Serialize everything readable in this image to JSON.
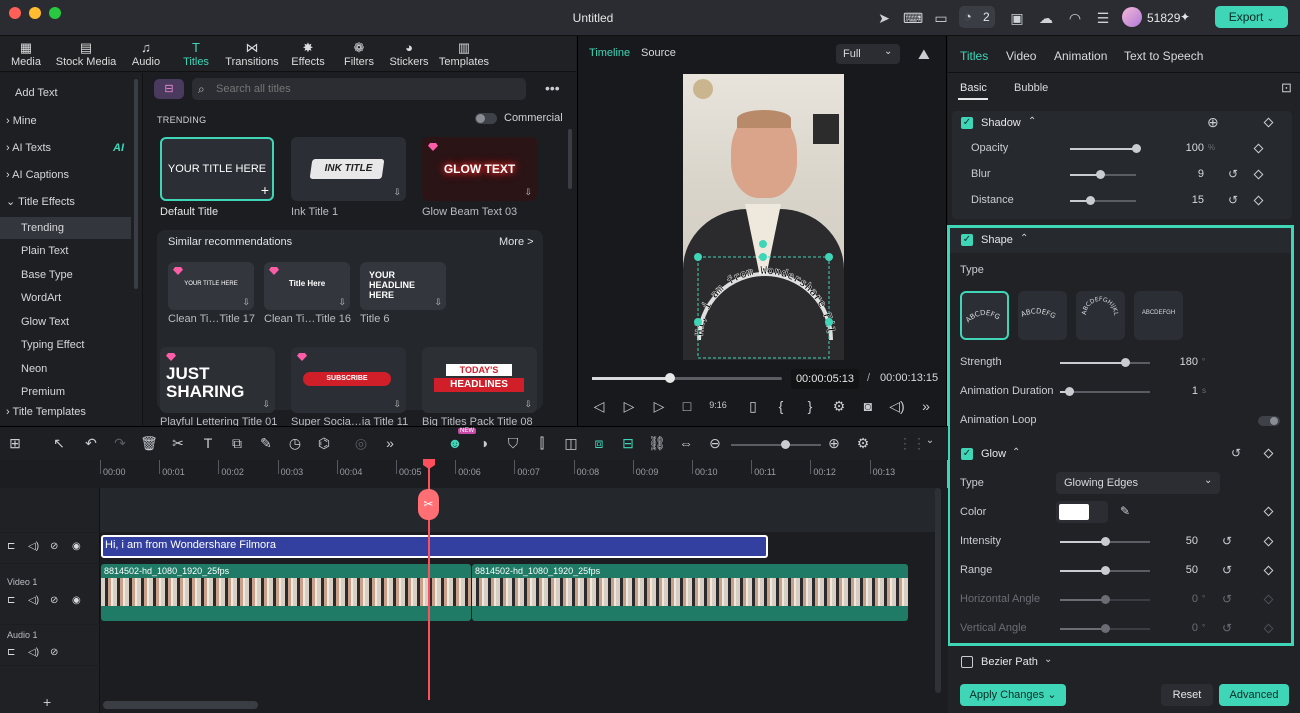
{
  "window": {
    "title": "Untitled",
    "credits": "51829",
    "export_label": "Export",
    "badge": "2"
  },
  "media_tabs": [
    {
      "label": "Media",
      "icon": "media-icon"
    },
    {
      "label": "Stock Media",
      "icon": "stock-icon"
    },
    {
      "label": "Audio",
      "icon": "audio-icon"
    },
    {
      "label": "Titles",
      "icon": "titles-icon"
    },
    {
      "label": "Transitions",
      "icon": "transitions-icon"
    },
    {
      "label": "Effects",
      "icon": "effects-icon"
    },
    {
      "label": "Filters",
      "icon": "filters-icon"
    },
    {
      "label": "Stickers",
      "icon": "stickers-icon"
    },
    {
      "label": "Templates",
      "icon": "templates-icon"
    }
  ],
  "left_nav": {
    "add_text": "Add Text",
    "items": [
      "Mine",
      "AI Texts",
      "AI Captions",
      "Title Effects"
    ],
    "ai_badge": "AI",
    "sub_items": [
      "Trending",
      "Plain Text",
      "Base Type",
      "WordArt",
      "Glow Text",
      "Typing Effect",
      "Neon",
      "Premium"
    ],
    "templates": "Title Templates"
  },
  "gallery": {
    "search_placeholder": "Search all titles",
    "trending": "TRENDING",
    "commercial": "Commercial",
    "cards": [
      {
        "label": "Default Title",
        "text": "YOUR TITLE HERE"
      },
      {
        "label": "Ink Title 1",
        "text": "INK TITLE"
      },
      {
        "label": "Glow Beam Text 03",
        "text": "GLOW TEXT"
      }
    ],
    "similar": "Similar recommendations",
    "more": "More >",
    "rec": [
      {
        "label": "Clean Ti…Title 17",
        "text": "YOUR TITLE HERE"
      },
      {
        "label": "Clean Ti…Title 16",
        "text": "Title Here"
      },
      {
        "label": "Title 6",
        "text": "YOUR HEADLINE HERE"
      }
    ],
    "row3": [
      {
        "label": "Playful Lettering Title 01",
        "text": "JUST SHARING"
      },
      {
        "label": "Super Socia…ia Title 11",
        "text": "SUBSCRIBE"
      },
      {
        "label": "Big Titles Pack Title 08",
        "text1": "TODAY'S",
        "text2": "HEADLINES"
      }
    ]
  },
  "preview": {
    "tab_timeline": "Timeline",
    "tab_source": "Source",
    "zoom": "Full",
    "curved_text": "Hi, i am from Wondershare Filmora",
    "current_time": "00:00:05:13",
    "separator": "/",
    "total_time": "00:00:13:15",
    "progress": 0.41
  },
  "right": {
    "tabs": [
      "Titles",
      "Video",
      "Animation",
      "Text to Speech"
    ],
    "subtabs": [
      "Basic",
      "Bubble"
    ],
    "shadow": {
      "title": "Shadow",
      "rows": [
        {
          "label": "Opacity",
          "value": "100",
          "unit": "%",
          "fraction": 1.0
        },
        {
          "label": "Blur",
          "value": "9",
          "fraction": 0.45
        },
        {
          "label": "Distance",
          "value": "15",
          "fraction": 0.3
        }
      ]
    },
    "shape": {
      "title": "Shape",
      "type_label": "Type",
      "types": [
        "ABCDEFG",
        "ABCDEFG",
        "ABCDEFGHIJKL",
        "ABCDEFGH"
      ],
      "rows": [
        {
          "label": "Strength",
          "value": "180",
          "unit": "°",
          "fraction": 0.72
        },
        {
          "label": "Animation Duration",
          "value": "1",
          "unit": "s",
          "fraction": 0.1
        }
      ],
      "loop": "Animation Loop"
    },
    "glow": {
      "title": "Glow",
      "type_label": "Type",
      "type_value": "Glowing Edges",
      "color_label": "Color",
      "rows": [
        {
          "label": "Intensity",
          "value": "50",
          "fraction": 0.5
        },
        {
          "label": "Range",
          "value": "50",
          "fraction": 0.5
        },
        {
          "label": "Horizontal Angle",
          "value": "0",
          "unit": "°",
          "fraction": 0.5
        },
        {
          "label": "Vertical Angle",
          "value": "0",
          "unit": "°",
          "fraction": 0.5
        }
      ]
    },
    "bezier": "Bezier Path",
    "apply": "Apply Changes",
    "reset": "Reset",
    "advanced": "Advanced"
  },
  "timeline": {
    "ticks": [
      "00:00",
      "00:01",
      "00:02",
      "00:03",
      "00:04",
      "00:05",
      "00:06",
      "00:07",
      "00:08",
      "00:09",
      "00:10",
      "00:11",
      "00:12",
      "00:13"
    ],
    "title_clip": "Hi, i am from Wondershare Filmora",
    "video_clip1": "8814502-hd_1080_1920_25fps",
    "video_clip2": "8814502-hd_1080_1920_25fps",
    "video_track": "Video 1",
    "audio_track": "Audio 1",
    "new_badge": "NEW"
  },
  "colors": {
    "accent": "#3fd6b8",
    "title_clip": "#3340a0",
    "video_clip": "#1f7a66",
    "playhead": "#ff4f5e"
  }
}
